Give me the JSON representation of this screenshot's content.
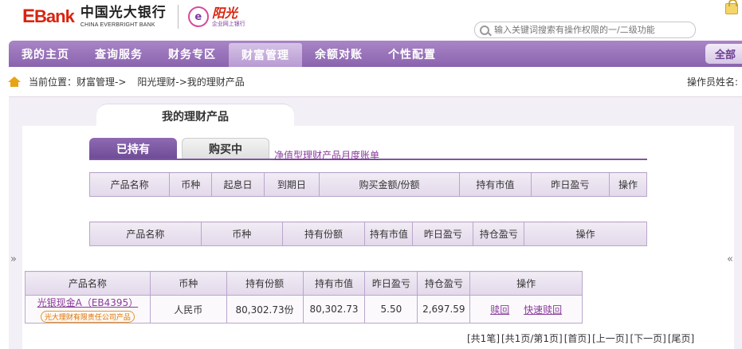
{
  "header": {
    "logo_ebank": "Bank",
    "logo_ebank_e": "E",
    "logo_cn": "中国光大银行",
    "logo_en": "CHINA EVERBRIGHT BANK",
    "sun_badge": "e",
    "sun_title": "阳光",
    "sun_sub": "企业网上银行",
    "search_placeholder": "输入关键词搜索有操作权限的一/二级功能"
  },
  "nav": {
    "items": [
      {
        "label": "我的主页"
      },
      {
        "label": "查询服务"
      },
      {
        "label": "财务专区"
      },
      {
        "label": "财富管理",
        "active": true
      },
      {
        "label": "余额对账"
      },
      {
        "label": "个性配置"
      }
    ],
    "all_label": "全部"
  },
  "breadcrumb": {
    "prefix": "当前位置：财富管理->",
    "path": "阳光理财->我的理财产品"
  },
  "operator_label": "操作员姓名:",
  "page_title": "我的理财产品",
  "tabs": [
    {
      "label": "已持有",
      "active": true
    },
    {
      "label": "购买中",
      "active": false
    }
  ],
  "tab_link": "净值型理财产品月度账单",
  "table1": {
    "headers": [
      "产品名称",
      "币种",
      "起息日",
      "到期日",
      "购买金额/份额",
      "持有市值",
      "昨日盈亏",
      "操作"
    ]
  },
  "table2": {
    "headers": [
      "产品名称",
      "币种",
      "持有份额",
      "持有市值",
      "昨日盈亏",
      "持仓盈亏",
      "操作"
    ]
  },
  "table3": {
    "headers": [
      "产品名称",
      "币种",
      "持有份额",
      "持有市值",
      "昨日盈亏",
      "持仓盈亏",
      "操作"
    ],
    "rows": [
      {
        "name": "光银现金A（EB4395）",
        "issuer_badge": "光大理财有限责任公司产品",
        "currency": "人民币",
        "shares": "80,302.73份",
        "market_value": "80,302.73",
        "yesterday_pl": "5.50",
        "position_pl": "2,697.59",
        "op_redeem": "赎回",
        "op_fast_redeem": "快速赎回"
      }
    ]
  },
  "pager": {
    "total": "[共1笔]",
    "pages": "[共1页/第1页]",
    "first": "[首页]",
    "prev": "[上一页]",
    "next": "[下一页]",
    "last": "[尾页]"
  },
  "side_arrows": {
    "left": "»",
    "right": "«"
  }
}
